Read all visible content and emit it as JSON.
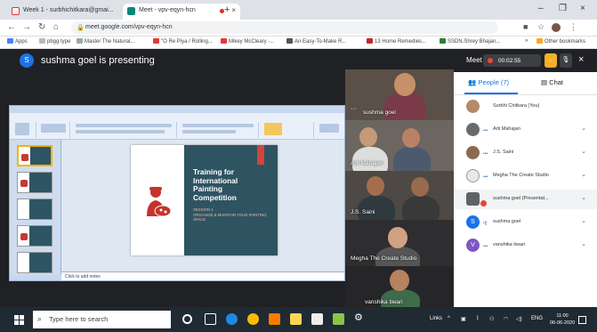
{
  "browser": {
    "tabs": [
      {
        "label": "Week 1 - surbhichitkara@gmai...",
        "close": "×"
      },
      {
        "label": "Meet - vpv-eqyn-hcn",
        "close": "×"
      }
    ],
    "new_tab": "+",
    "window_controls": {
      "minimize": "–",
      "maximize": "❐",
      "close": "×"
    },
    "url": "meet.google.com/vpv-eqyn-hcn",
    "bookmarks": [
      "Apps",
      "pbgg type",
      "Master The Natural...",
      "\"O Re Piya / Rolling...",
      "Mikey McCleary -...",
      "An Easy-To-Make R...",
      "13 Home Remedies...",
      "SSDN.Shrey Bhajan..."
    ],
    "bookmarks_more": "»",
    "other_bookmarks": "Other bookmarks"
  },
  "meet": {
    "presenter_avatar": "S",
    "presenter_text": "sushma goel is presenting",
    "slide": {
      "title": "Training for International Painting Competition",
      "session": "SESSION 1",
      "subtitle": "ORGANIZE & MAINTAIN YOUR PAINTING SPACE"
    },
    "notes_placeholder": "Click to add notes",
    "tiles": [
      {
        "name": "sushma goel"
      },
      {
        "name": "Arti Mahajan"
      },
      {
        "name": "J.S. Saini"
      },
      {
        "name": "Megha The Create Studio"
      },
      {
        "name": "vanshika tiwari"
      }
    ]
  },
  "panel": {
    "meeting_label": "Meet",
    "timer": "00:02:55",
    "tabs": {
      "people": "People (7)",
      "chat": "Chat"
    },
    "participants": [
      {
        "name": "Surbhi Chitkara (You)",
        "color": "#b5896a"
      },
      {
        "name": "Arti Mahajan",
        "color": "#6b6b6b"
      },
      {
        "name": "J.S. Saini",
        "color": "#8a6a52"
      },
      {
        "name": "Megha The Create Studio",
        "color": "#e8e8e8"
      },
      {
        "name": "sushma goel (Presentat...",
        "color": "#5f6368",
        "highlighted": true
      },
      {
        "name": "sushma goel",
        "color": "#1a73e8",
        "initial": "S"
      },
      {
        "name": "vanshika tiwari",
        "color": "#7e57c2",
        "initial": "V"
      }
    ]
  },
  "taskbar": {
    "search_placeholder": "Type here to search",
    "tray_label": "Links",
    "tray_lang": "ENG",
    "time": "11:00",
    "date": "06-06-2020"
  },
  "colors": {
    "meet_bg": "#202124",
    "accent": "#1a73e8",
    "record": "#ea4335",
    "hand": "#f6ae2d",
    "slide_teal": "#2e5462",
    "slide_red": "#d2453a"
  }
}
